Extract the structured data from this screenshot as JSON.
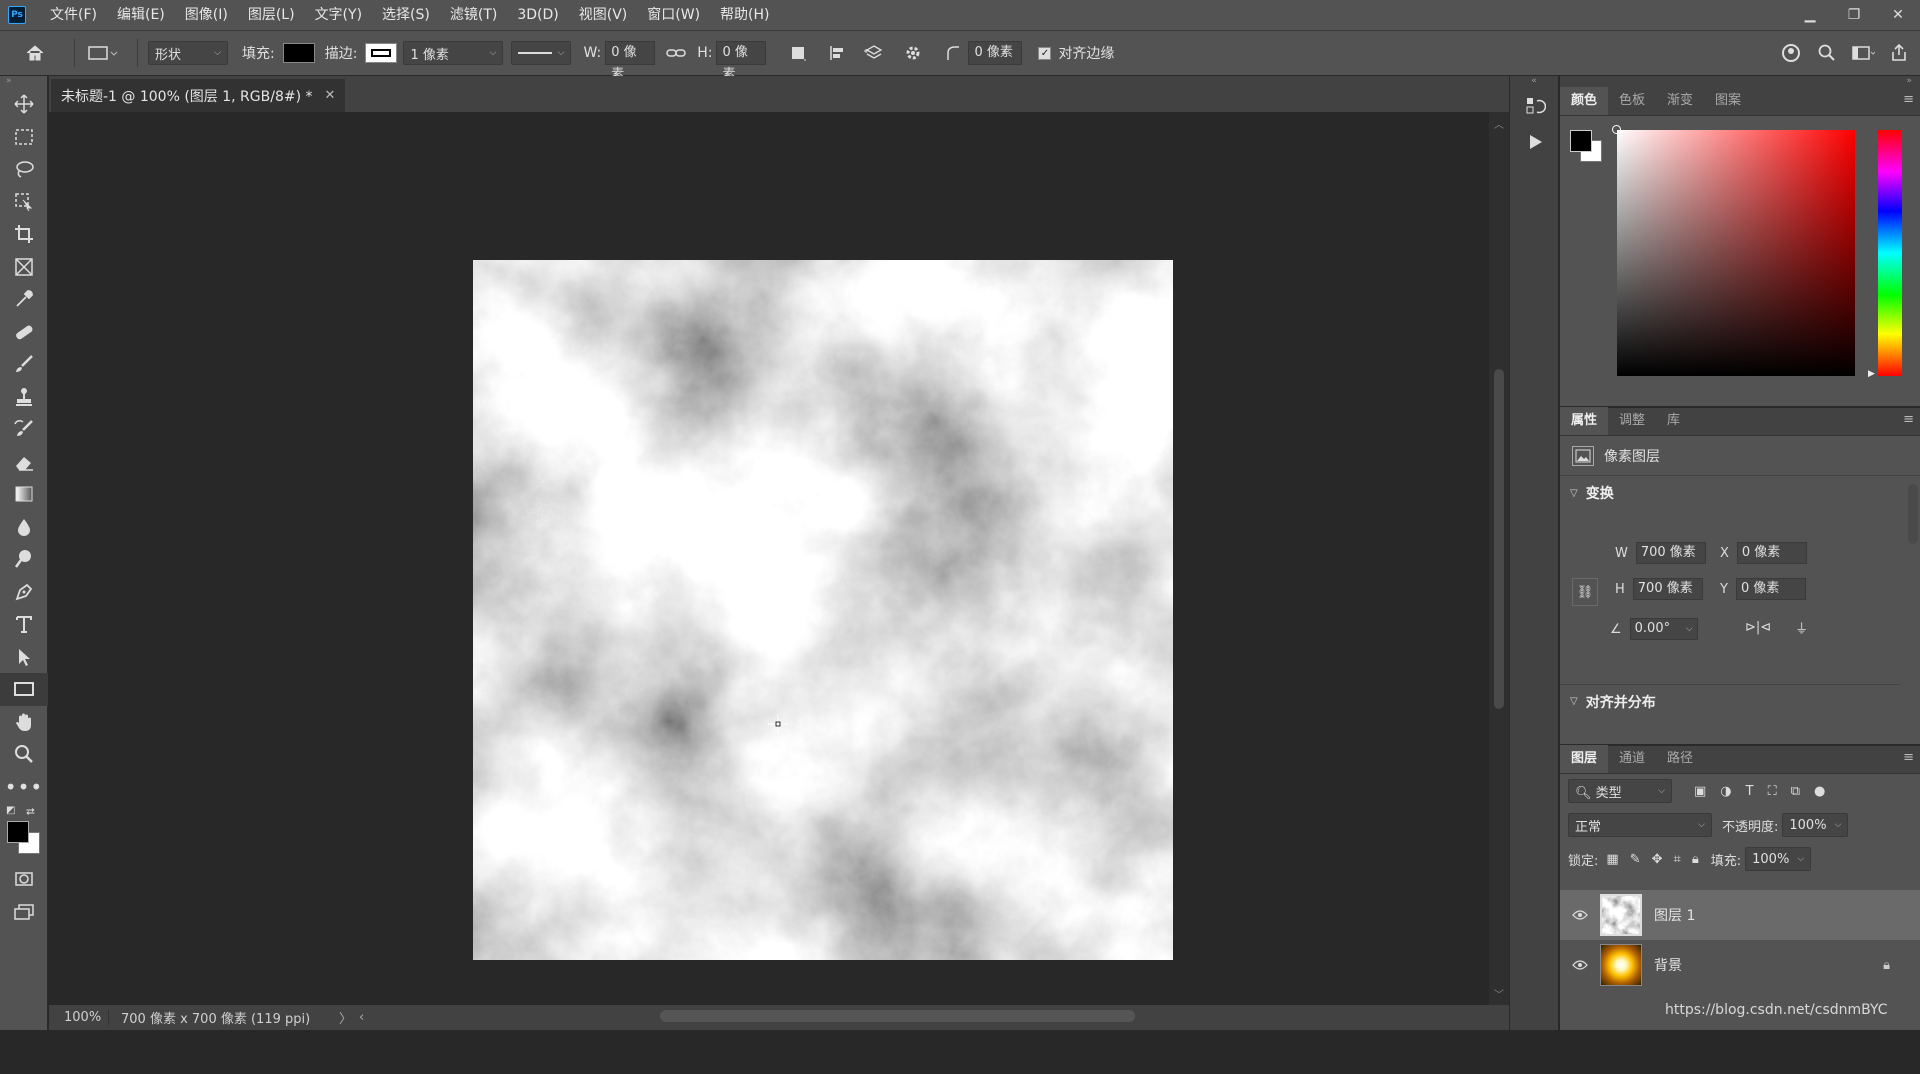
{
  "menubar": {
    "items": [
      "文件(F)",
      "编辑(E)",
      "图像(I)",
      "图层(L)",
      "文字(Y)",
      "选择(S)",
      "滤镜(T)",
      "3D(D)",
      "视图(V)",
      "窗口(W)",
      "帮助(H)"
    ],
    "app_icon": "Ps"
  },
  "options": {
    "mode_value": "形状",
    "fill_label": "填充:",
    "stroke_label": "描边:",
    "stroke_width": "1 像素",
    "w_label": "W:",
    "w_value": "0 像素",
    "h_label": "H:",
    "h_value": "0 像素",
    "radius_value": "0 像素",
    "align_edges_label": "对齐边缘"
  },
  "document": {
    "tab_title": "未标题-1 @ 100% (图层 1, RGB/8#) *",
    "zoom": "100%",
    "info": "700 像素 x 700 像素 (119 ppi)"
  },
  "color_panel": {
    "tabs": [
      "颜色",
      "色板",
      "渐变",
      "图案"
    ],
    "foreground": "#000000",
    "background": "#ffffff"
  },
  "properties_panel": {
    "tabs": [
      "属性",
      "调整",
      "库"
    ],
    "layer_type": "像素图层",
    "transform_title": "变换",
    "w_label": "W",
    "w_value": "700 像素",
    "h_label": "H",
    "h_value": "700 像素",
    "x_label": "X",
    "x_value": "0 像素",
    "y_label": "Y",
    "y_value": "0 像素",
    "angle_value": "0.00°",
    "align_title": "对齐并分布"
  },
  "layers_panel": {
    "tabs": [
      "图层",
      "通道",
      "路径"
    ],
    "filter_kind": "类型",
    "blend_mode": "正常",
    "opacity_label": "不透明度:",
    "opacity_value": "100%",
    "lock_label": "锁定:",
    "fill_label": "填充:",
    "fill_value": "100%",
    "layers": [
      {
        "name": "图层 1",
        "selected": true
      },
      {
        "name": "背景",
        "locked": true
      }
    ]
  },
  "watermark": "https://blog.csdn.net/csdnmBYC"
}
